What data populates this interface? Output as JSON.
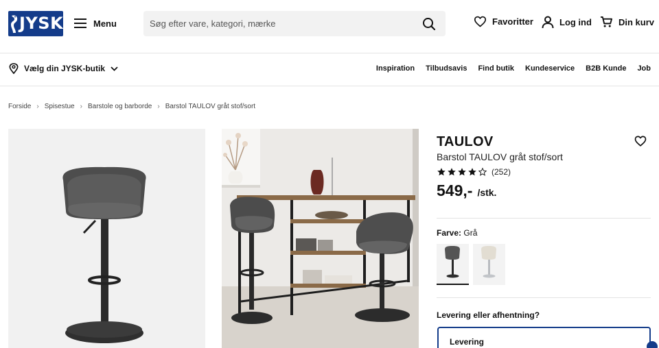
{
  "header": {
    "logo_text": "JYSK",
    "menu_label": "Menu",
    "search_placeholder": "Søg efter vare, kategori, mærke",
    "favorites_label": "Favoritter",
    "login_label": "Log ind",
    "cart_label": "Din kurv",
    "brand_color": "#143c8a"
  },
  "subnav": {
    "store_label": "Vælg din JYSK-butik",
    "links": [
      "Inspiration",
      "Tilbudsavis",
      "Find butik",
      "Kundeservice",
      "B2B Kunde",
      "Job"
    ]
  },
  "breadcrumb": [
    "Forside",
    "Spisestue",
    "Barstole og barborde",
    "Barstol TAULOV gråt stof/sort"
  ],
  "product": {
    "name": "TAULOV",
    "subtitle": "Barstol TAULOV gråt stof/sort",
    "rating": 4,
    "rating_max": 5,
    "review_count": "(252)",
    "price": "549,-",
    "price_unit": "/stk.",
    "color_label": "Farve:",
    "color_value": "Grå",
    "swatches": [
      "grå",
      "beige"
    ],
    "delivery_question": "Levering eller afhentning?",
    "delivery_option": "Levering"
  }
}
